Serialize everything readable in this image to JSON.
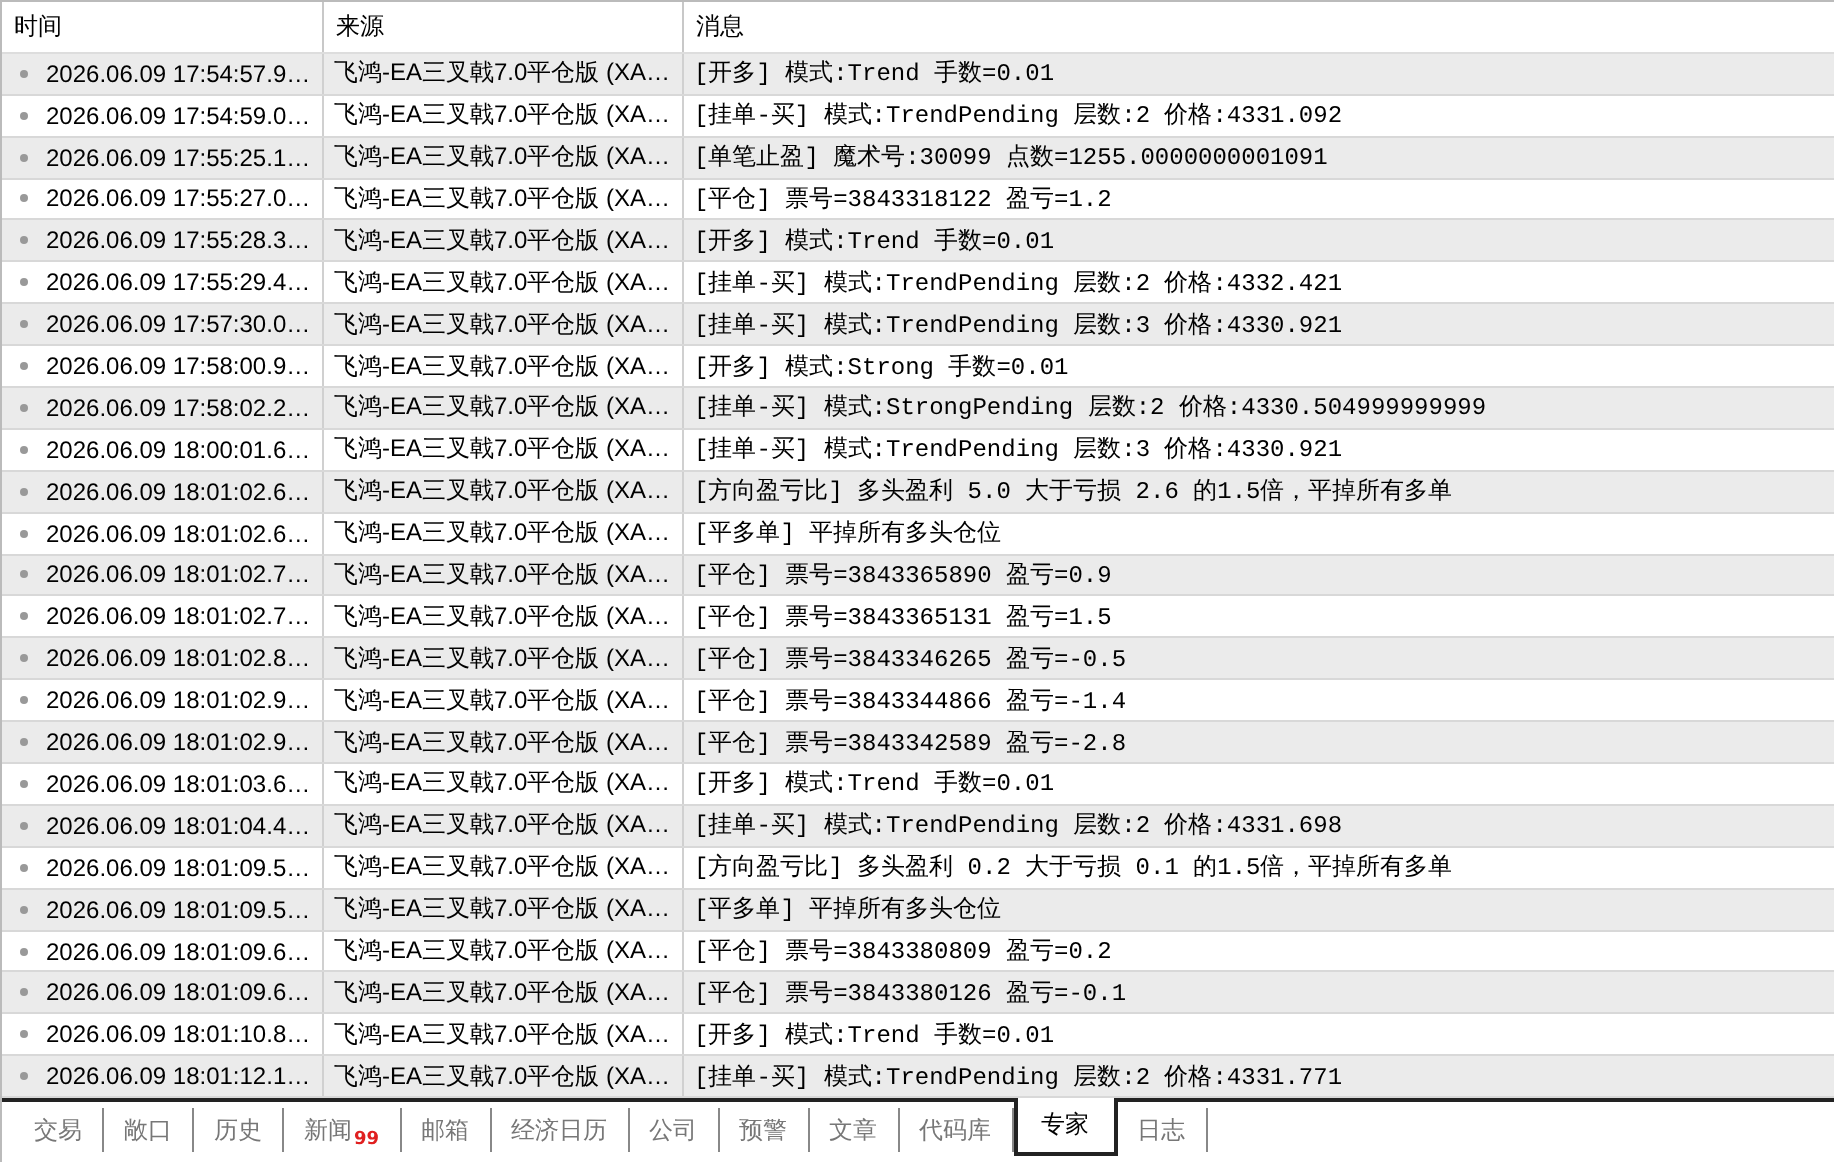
{
  "table": {
    "columns": [
      "时间",
      "来源",
      "消息"
    ],
    "rows": [
      {
        "time": "2026.06.09 17:54:57.9…",
        "source": "飞鸿-EA三叉戟7.0平仓版 (XA…",
        "message": "[开多] 模式:Trend 手数=0.01"
      },
      {
        "time": "2026.06.09 17:54:59.0…",
        "source": "飞鸿-EA三叉戟7.0平仓版 (XA…",
        "message": "[挂单-买] 模式:TrendPending 层数:2 价格:4331.092"
      },
      {
        "time": "2026.06.09 17:55:25.1…",
        "source": "飞鸿-EA三叉戟7.0平仓版 (XA…",
        "message": "[单笔止盈] 魔术号:30099 点数=1255.0000000001091"
      },
      {
        "time": "2026.06.09 17:55:27.0…",
        "source": "飞鸿-EA三叉戟7.0平仓版 (XA…",
        "message": "[平仓] 票号=3843318122 盈亏=1.2"
      },
      {
        "time": "2026.06.09 17:55:28.3…",
        "source": "飞鸿-EA三叉戟7.0平仓版 (XA…",
        "message": "[开多] 模式:Trend 手数=0.01"
      },
      {
        "time": "2026.06.09 17:55:29.4…",
        "source": "飞鸿-EA三叉戟7.0平仓版 (XA…",
        "message": "[挂单-买] 模式:TrendPending 层数:2 价格:4332.421"
      },
      {
        "time": "2026.06.09 17:57:30.0…",
        "source": "飞鸿-EA三叉戟7.0平仓版 (XA…",
        "message": "[挂单-买] 模式:TrendPending 层数:3 价格:4330.921"
      },
      {
        "time": "2026.06.09 17:58:00.9…",
        "source": "飞鸿-EA三叉戟7.0平仓版 (XA…",
        "message": "[开多] 模式:Strong 手数=0.01"
      },
      {
        "time": "2026.06.09 17:58:02.2…",
        "source": "飞鸿-EA三叉戟7.0平仓版 (XA…",
        "message": "[挂单-买] 模式:StrongPending 层数:2 价格:4330.504999999999"
      },
      {
        "time": "2026.06.09 18:00:01.6…",
        "source": "飞鸿-EA三叉戟7.0平仓版 (XA…",
        "message": "[挂单-买] 模式:TrendPending 层数:3 价格:4330.921"
      },
      {
        "time": "2026.06.09 18:01:02.6…",
        "source": "飞鸿-EA三叉戟7.0平仓版 (XA…",
        "message": "[方向盈亏比] 多头盈利 5.0 大于亏损 2.6 的1.5倍，平掉所有多单"
      },
      {
        "time": "2026.06.09 18:01:02.6…",
        "source": "飞鸿-EA三叉戟7.0平仓版 (XA…",
        "message": "[平多单] 平掉所有多头仓位"
      },
      {
        "time": "2026.06.09 18:01:02.7…",
        "source": "飞鸿-EA三叉戟7.0平仓版 (XA…",
        "message": "[平仓] 票号=3843365890 盈亏=0.9"
      },
      {
        "time": "2026.06.09 18:01:02.7…",
        "source": "飞鸿-EA三叉戟7.0平仓版 (XA…",
        "message": "[平仓] 票号=3843365131 盈亏=1.5"
      },
      {
        "time": "2026.06.09 18:01:02.8…",
        "source": "飞鸿-EA三叉戟7.0平仓版 (XA…",
        "message": "[平仓] 票号=3843346265 盈亏=-0.5"
      },
      {
        "time": "2026.06.09 18:01:02.9…",
        "source": "飞鸿-EA三叉戟7.0平仓版 (XA…",
        "message": "[平仓] 票号=3843344866 盈亏=-1.4"
      },
      {
        "time": "2026.06.09 18:01:02.9…",
        "source": "飞鸿-EA三叉戟7.0平仓版 (XA…",
        "message": "[平仓] 票号=3843342589 盈亏=-2.8"
      },
      {
        "time": "2026.06.09 18:01:03.6…",
        "source": "飞鸿-EA三叉戟7.0平仓版 (XA…",
        "message": "[开多] 模式:Trend 手数=0.01"
      },
      {
        "time": "2026.06.09 18:01:04.4…",
        "source": "飞鸿-EA三叉戟7.0平仓版 (XA…",
        "message": "[挂单-买] 模式:TrendPending 层数:2 价格:4331.698"
      },
      {
        "time": "2026.06.09 18:01:09.5…",
        "source": "飞鸿-EA三叉戟7.0平仓版 (XA…",
        "message": "[方向盈亏比] 多头盈利 0.2 大于亏损 0.1 的1.5倍，平掉所有多单"
      },
      {
        "time": "2026.06.09 18:01:09.5…",
        "source": "飞鸿-EA三叉戟7.0平仓版 (XA…",
        "message": "[平多单] 平掉所有多头仓位"
      },
      {
        "time": "2026.06.09 18:01:09.6…",
        "source": "飞鸿-EA三叉戟7.0平仓版 (XA…",
        "message": "[平仓] 票号=3843380809 盈亏=0.2"
      },
      {
        "time": "2026.06.09 18:01:09.6…",
        "source": "飞鸿-EA三叉戟7.0平仓版 (XA…",
        "message": "[平仓] 票号=3843380126 盈亏=-0.1"
      },
      {
        "time": "2026.06.09 18:01:10.8…",
        "source": "飞鸿-EA三叉戟7.0平仓版 (XA…",
        "message": "[开多] 模式:Trend 手数=0.01"
      },
      {
        "time": "2026.06.09 18:01:12.1…",
        "source": "飞鸿-EA三叉戟7.0平仓版 (XA…",
        "message": "[挂单-买] 模式:TrendPending 层数:2 价格:4331.771"
      }
    ]
  },
  "tabs": [
    {
      "label": "交易",
      "selected": false
    },
    {
      "label": "敞口",
      "selected": false
    },
    {
      "label": "历史",
      "selected": false
    },
    {
      "label": "新闻",
      "badge": "99",
      "selected": false
    },
    {
      "label": "邮箱",
      "selected": false
    },
    {
      "label": "经济日历",
      "selected": false
    },
    {
      "label": "公司",
      "selected": false
    },
    {
      "label": "预警",
      "selected": false
    },
    {
      "label": "文章",
      "selected": false
    },
    {
      "label": "代码库",
      "selected": false
    },
    {
      "label": "专家",
      "selected": true
    },
    {
      "label": "日志",
      "selected": false
    }
  ]
}
